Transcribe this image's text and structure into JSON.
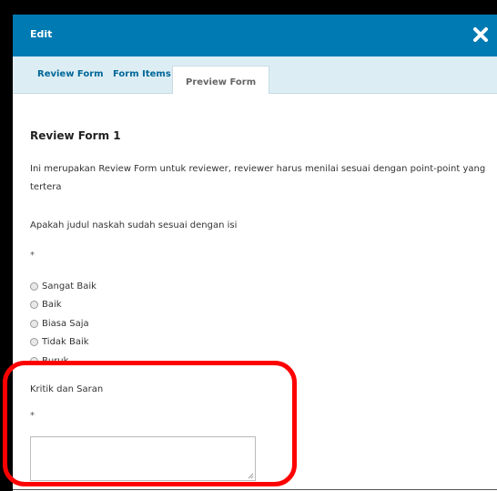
{
  "modal": {
    "title": "Edit",
    "close_icon": "close-icon"
  },
  "tabs": [
    {
      "label": "Review Form",
      "active": false
    },
    {
      "label": "Form Items",
      "active": false
    },
    {
      "label": "Preview Form",
      "active": true
    }
  ],
  "form": {
    "title": "Review Form 1",
    "description": "Ini merupakan Review Form untuk reviewer, reviewer harus menilai sesuai dengan point-point yang tertera",
    "question_1": {
      "label": "Apakah judul naskah sudah sesuai dengan isi",
      "required_marker": "*",
      "options": [
        "Sangat Baik",
        "Baik",
        "Biasa Saja",
        "Tidak Baik",
        "Buruk"
      ]
    },
    "question_2": {
      "label": "Kritik dan Saran",
      "required_marker": "*",
      "value": ""
    }
  },
  "colors": {
    "header": "#007ab2",
    "tabs_bar": "#ddedf4",
    "tab_link": "#006798",
    "highlight": "#ff0000"
  }
}
